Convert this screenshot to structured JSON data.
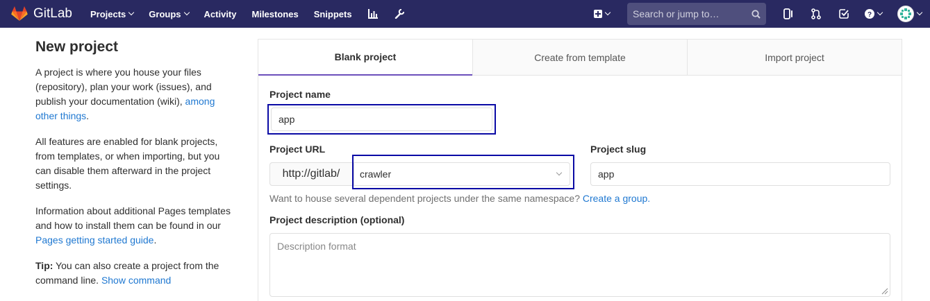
{
  "navbar": {
    "brand": "GitLab",
    "links": [
      {
        "label": "Projects",
        "dropdown": true
      },
      {
        "label": "Groups",
        "dropdown": true
      },
      {
        "label": "Activity",
        "dropdown": false
      },
      {
        "label": "Milestones",
        "dropdown": false
      },
      {
        "label": "Snippets",
        "dropdown": false
      }
    ],
    "search_placeholder": "Search or jump to…",
    "bg_color": "#292961"
  },
  "sidebar": {
    "title": "New project",
    "p1": "A project is where you house your files (repository), plan your work (issues), and publish your documentation (wiki), ",
    "p1_link": "among other things",
    "p1_end": ".",
    "p2": "All features are enabled for blank projects, from templates, or when importing, but you can disable them afterward in the project settings.",
    "p3": "Information about additional Pages templates and how to install them can be found in our ",
    "p3_link": "Pages getting started guide",
    "p3_end": ".",
    "tip_bold": "Tip:",
    "tip_text": " You can also create a project from the command line. ",
    "tip_link": "Show command"
  },
  "tabs": [
    {
      "label": "Blank project",
      "active": true
    },
    {
      "label": "Create from template",
      "active": false
    },
    {
      "label": "Import project",
      "active": false
    }
  ],
  "form": {
    "name_label": "Project name",
    "name_value": "app",
    "url_label": "Project URL",
    "url_prefix": "http://gitlab/",
    "namespace_value": "crawler",
    "slug_label": "Project slug",
    "slug_value": "app",
    "help_text": "Want to house several dependent projects under the same namespace? ",
    "help_link": "Create a group.",
    "desc_label": "Project description (optional)",
    "desc_placeholder": "Description format"
  }
}
